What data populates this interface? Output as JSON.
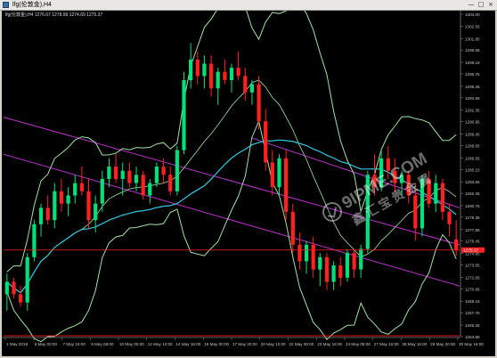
{
  "window": {
    "title": "lfg(伦敦金),H4",
    "controls": {
      "minimize": "—",
      "maximize": "□",
      "close": "×"
    }
  },
  "chart_info": "lfg(伦敦金),H4  1276.67 1278.99 1274.69 1275.37",
  "colors": {
    "background": "#000000",
    "bull": "#00e07a",
    "bear": "#ff2020",
    "bands": "#9ee3a0",
    "ma": "#2ec8e0",
    "channel": "#c030d0",
    "price_line": "#ff2020",
    "axis_text": "#c8c8c8"
  },
  "price_axis": {
    "labels": [
      "1304.00",
      "1302.55",
      "1301.05",
      "1299.65",
      "1298.15",
      "1296.75",
      "1295.25",
      "1293.85",
      "1292.35",
      "1290.95",
      "1289.45",
      "1288.05",
      "1286.55",
      "1285.15",
      "1283.65",
      "1282.25",
      "1280.75",
      "1279.35",
      "1277.85",
      "1276.45",
      "1274.95",
      "1273.55",
      "1272.05",
      "1270.65",
      "1269.15",
      "1267.75",
      "1266.25",
      "1264.85"
    ],
    "current_price": "1275.37",
    "marker_price": "1276.20"
  },
  "time_axis": {
    "labels": [
      "1 May 2019",
      "6 May 00:00",
      "7 May 16:00",
      "9 May 08:00",
      "10 May 00:00",
      "13 May 12:00",
      "14 May 16:00",
      "16 May 00:00",
      "17 May 20:00",
      "20 May 12:00",
      "22 May 00:00",
      "23 May 16:00",
      "24 May 08:00",
      "27 May 16:00",
      "28 May 16:00",
      "29 May 20:00",
      "30 May 16:00"
    ]
  },
  "chart_data": {
    "type": "candlestick",
    "symbol": "lfg(伦敦金)",
    "timeframe": "H4",
    "ylim": [
      1264.85,
      1304.0
    ],
    "ohlc_last": {
      "open": 1276.67,
      "high": 1278.99,
      "low": 1274.69,
      "close": 1275.37
    },
    "candles": [
      [
        1270.0,
        1272.5,
        1268.0,
        1271.5
      ],
      [
        1271.5,
        1272.0,
        1269.5,
        1270.0
      ],
      [
        1270.0,
        1271.0,
        1268.5,
        1269.0
      ],
      [
        1269.0,
        1275.0,
        1268.0,
        1274.5
      ],
      [
        1274.5,
        1279.0,
        1274.0,
        1278.5
      ],
      [
        1278.5,
        1281.0,
        1277.0,
        1280.5
      ],
      [
        1280.5,
        1282.0,
        1278.5,
        1279.0
      ],
      [
        1279.0,
        1283.5,
        1278.0,
        1282.5
      ],
      [
        1282.5,
        1284.0,
        1280.0,
        1281.0
      ],
      [
        1281.0,
        1283.0,
        1279.5,
        1282.0
      ],
      [
        1282.0,
        1284.5,
        1281.0,
        1283.5
      ],
      [
        1283.5,
        1285.5,
        1282.0,
        1282.5
      ],
      [
        1282.5,
        1284.0,
        1278.0,
        1279.0
      ],
      [
        1279.0,
        1282.0,
        1277.5,
        1281.0
      ],
      [
        1281.0,
        1285.0,
        1280.0,
        1284.0
      ],
      [
        1284.0,
        1286.5,
        1283.0,
        1285.5
      ],
      [
        1285.5,
        1287.0,
        1283.5,
        1284.0
      ],
      [
        1284.0,
        1286.0,
        1282.0,
        1285.0
      ],
      [
        1285.0,
        1286.0,
        1283.0,
        1283.5
      ],
      [
        1283.5,
        1285.5,
        1282.5,
        1284.5
      ],
      [
        1284.5,
        1285.0,
        1281.5,
        1282.0
      ],
      [
        1282.0,
        1284.0,
        1281.0,
        1283.5
      ],
      [
        1283.5,
        1286.0,
        1283.0,
        1285.5
      ],
      [
        1285.5,
        1286.5,
        1283.5,
        1284.5
      ],
      [
        1284.5,
        1285.5,
        1282.0,
        1282.5
      ],
      [
        1282.5,
        1288.0,
        1282.0,
        1287.5
      ],
      [
        1287.5,
        1297.0,
        1287.0,
        1296.0
      ],
      [
        1296.0,
        1300.5,
        1295.0,
        1298.5
      ],
      [
        1298.5,
        1299.5,
        1295.5,
        1296.5
      ],
      [
        1296.5,
        1299.0,
        1295.0,
        1298.0
      ],
      [
        1298.0,
        1299.0,
        1294.0,
        1295.0
      ],
      [
        1295.0,
        1297.5,
        1293.0,
        1297.0
      ],
      [
        1297.0,
        1298.5,
        1295.5,
        1296.0
      ],
      [
        1296.0,
        1298.0,
        1294.5,
        1297.5
      ],
      [
        1297.5,
        1299.5,
        1296.0,
        1296.5
      ],
      [
        1296.5,
        1297.5,
        1293.5,
        1294.5
      ],
      [
        1294.5,
        1296.0,
        1293.0,
        1295.5
      ],
      [
        1295.5,
        1296.5,
        1290.0,
        1291.0
      ],
      [
        1291.0,
        1292.5,
        1285.0,
        1286.0
      ],
      [
        1286.0,
        1287.5,
        1282.0,
        1283.0
      ],
      [
        1283.0,
        1287.0,
        1282.0,
        1286.5
      ],
      [
        1286.5,
        1287.5,
        1279.0,
        1280.0
      ],
      [
        1280.0,
        1281.0,
        1275.0,
        1276.0
      ],
      [
        1276.0,
        1277.5,
        1273.0,
        1274.0
      ],
      [
        1274.0,
        1276.5,
        1272.5,
        1276.0
      ],
      [
        1276.0,
        1277.0,
        1272.0,
        1273.0
      ],
      [
        1273.0,
        1275.0,
        1271.0,
        1274.5
      ],
      [
        1274.5,
        1275.0,
        1270.5,
        1271.5
      ],
      [
        1271.5,
        1274.0,
        1270.5,
        1273.5
      ],
      [
        1273.5,
        1274.5,
        1271.0,
        1272.0
      ],
      [
        1272.0,
        1275.5,
        1271.5,
        1275.0
      ],
      [
        1275.0,
        1275.5,
        1272.0,
        1273.0
      ],
      [
        1273.0,
        1276.0,
        1272.0,
        1275.5
      ],
      [
        1275.5,
        1285.0,
        1275.0,
        1284.5
      ],
      [
        1284.5,
        1287.0,
        1282.0,
        1283.0
      ],
      [
        1283.0,
        1287.5,
        1282.5,
        1286.5
      ],
      [
        1286.5,
        1288.0,
        1284.0,
        1285.0
      ],
      [
        1285.0,
        1286.5,
        1282.5,
        1283.5
      ],
      [
        1283.5,
        1285.0,
        1282.0,
        1284.5
      ],
      [
        1284.5,
        1285.0,
        1281.0,
        1282.0
      ],
      [
        1282.0,
        1283.5,
        1276.5,
        1278.0
      ],
      [
        1278.0,
        1284.5,
        1277.0,
        1284.0
      ],
      [
        1284.0,
        1285.0,
        1280.5,
        1281.0
      ],
      [
        1281.0,
        1284.5,
        1280.0,
        1283.5
      ],
      [
        1283.5,
        1284.0,
        1279.0,
        1280.0
      ],
      [
        1280.0,
        1281.0,
        1277.0,
        1278.5
      ],
      [
        1276.67,
        1278.99,
        1274.69,
        1275.37
      ]
    ],
    "indicators": [
      "Bollinger Bands",
      "Moving Average",
      "Trend Channel"
    ]
  }
}
